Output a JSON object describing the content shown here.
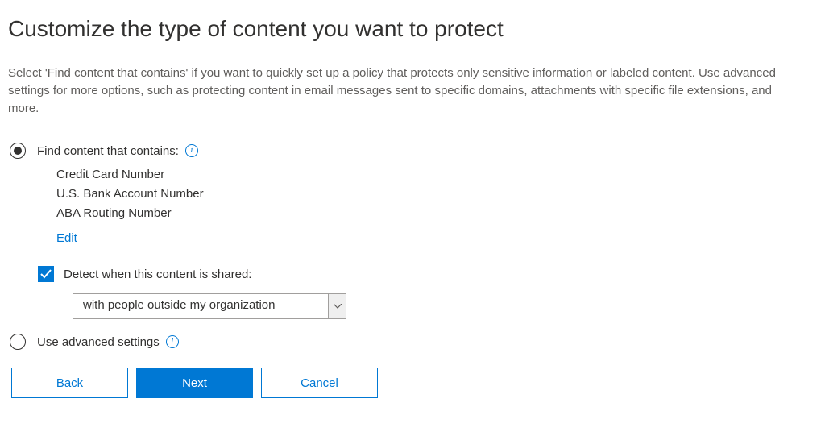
{
  "heading": "Customize the type of content you want to protect",
  "description": "Select 'Find content that contains' if you want to quickly set up a policy that protects only sensitive information or labeled content. Use advanced settings for more options, such as protecting content in email messages sent to specific domains, attachments with specific file extensions, and more.",
  "option1": {
    "label": "Find content that contains:",
    "items": [
      "Credit Card Number",
      "U.S. Bank Account Number",
      "ABA Routing Number"
    ],
    "edit_label": "Edit"
  },
  "detect": {
    "label": "Detect when this content is shared:",
    "selected": "with people outside my organization"
  },
  "option2": {
    "label": "Use advanced settings"
  },
  "buttons": {
    "back": "Back",
    "next": "Next",
    "cancel": "Cancel"
  }
}
